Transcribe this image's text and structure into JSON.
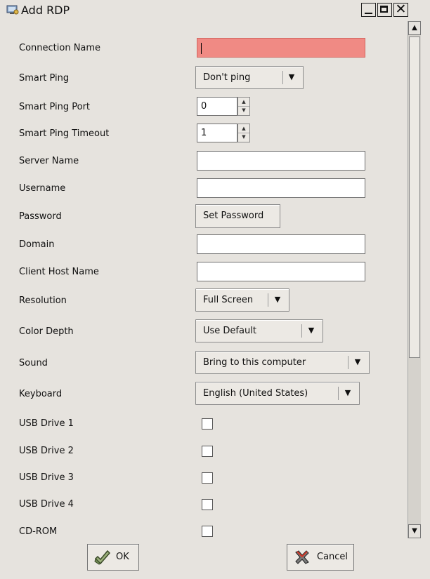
{
  "window": {
    "title": "Add RDP"
  },
  "form": {
    "connection_name": {
      "label": "Connection Name",
      "value": ""
    },
    "smart_ping": {
      "label": "Smart Ping",
      "value": "Don't ping"
    },
    "smart_ping_port": {
      "label": "Smart Ping Port",
      "value": "0"
    },
    "smart_ping_timeout": {
      "label": "Smart Ping Timeout",
      "value": "1"
    },
    "server_name": {
      "label": "Server Name",
      "value": ""
    },
    "username": {
      "label": "Username",
      "value": ""
    },
    "password": {
      "label": "Password",
      "button": "Set Password"
    },
    "domain": {
      "label": "Domain",
      "value": ""
    },
    "client_host_name": {
      "label": "Client Host Name",
      "value": ""
    },
    "resolution": {
      "label": "Resolution",
      "value": "Full Screen"
    },
    "color_depth": {
      "label": "Color Depth",
      "value": "Use Default"
    },
    "sound": {
      "label": "Sound",
      "value": "Bring to this computer"
    },
    "keyboard": {
      "label": "Keyboard",
      "value": "English (United States)"
    },
    "usb_drive_1": {
      "label": "USB Drive 1",
      "checked": false
    },
    "usb_drive_2": {
      "label": "USB Drive 2",
      "checked": false
    },
    "usb_drive_3": {
      "label": "USB Drive 3",
      "checked": false
    },
    "usb_drive_4": {
      "label": "USB Drive 4",
      "checked": false
    },
    "cd_rom": {
      "label": "CD-ROM",
      "checked": false
    }
  },
  "footer": {
    "ok_label": "OK",
    "cancel_label": "Cancel"
  },
  "colors": {
    "background": "#e6e3de",
    "required_field": "#f08a84"
  },
  "icons": {
    "app": "rdp-icon",
    "ok": "ok-icon",
    "cancel": "cancel-x-icon"
  }
}
